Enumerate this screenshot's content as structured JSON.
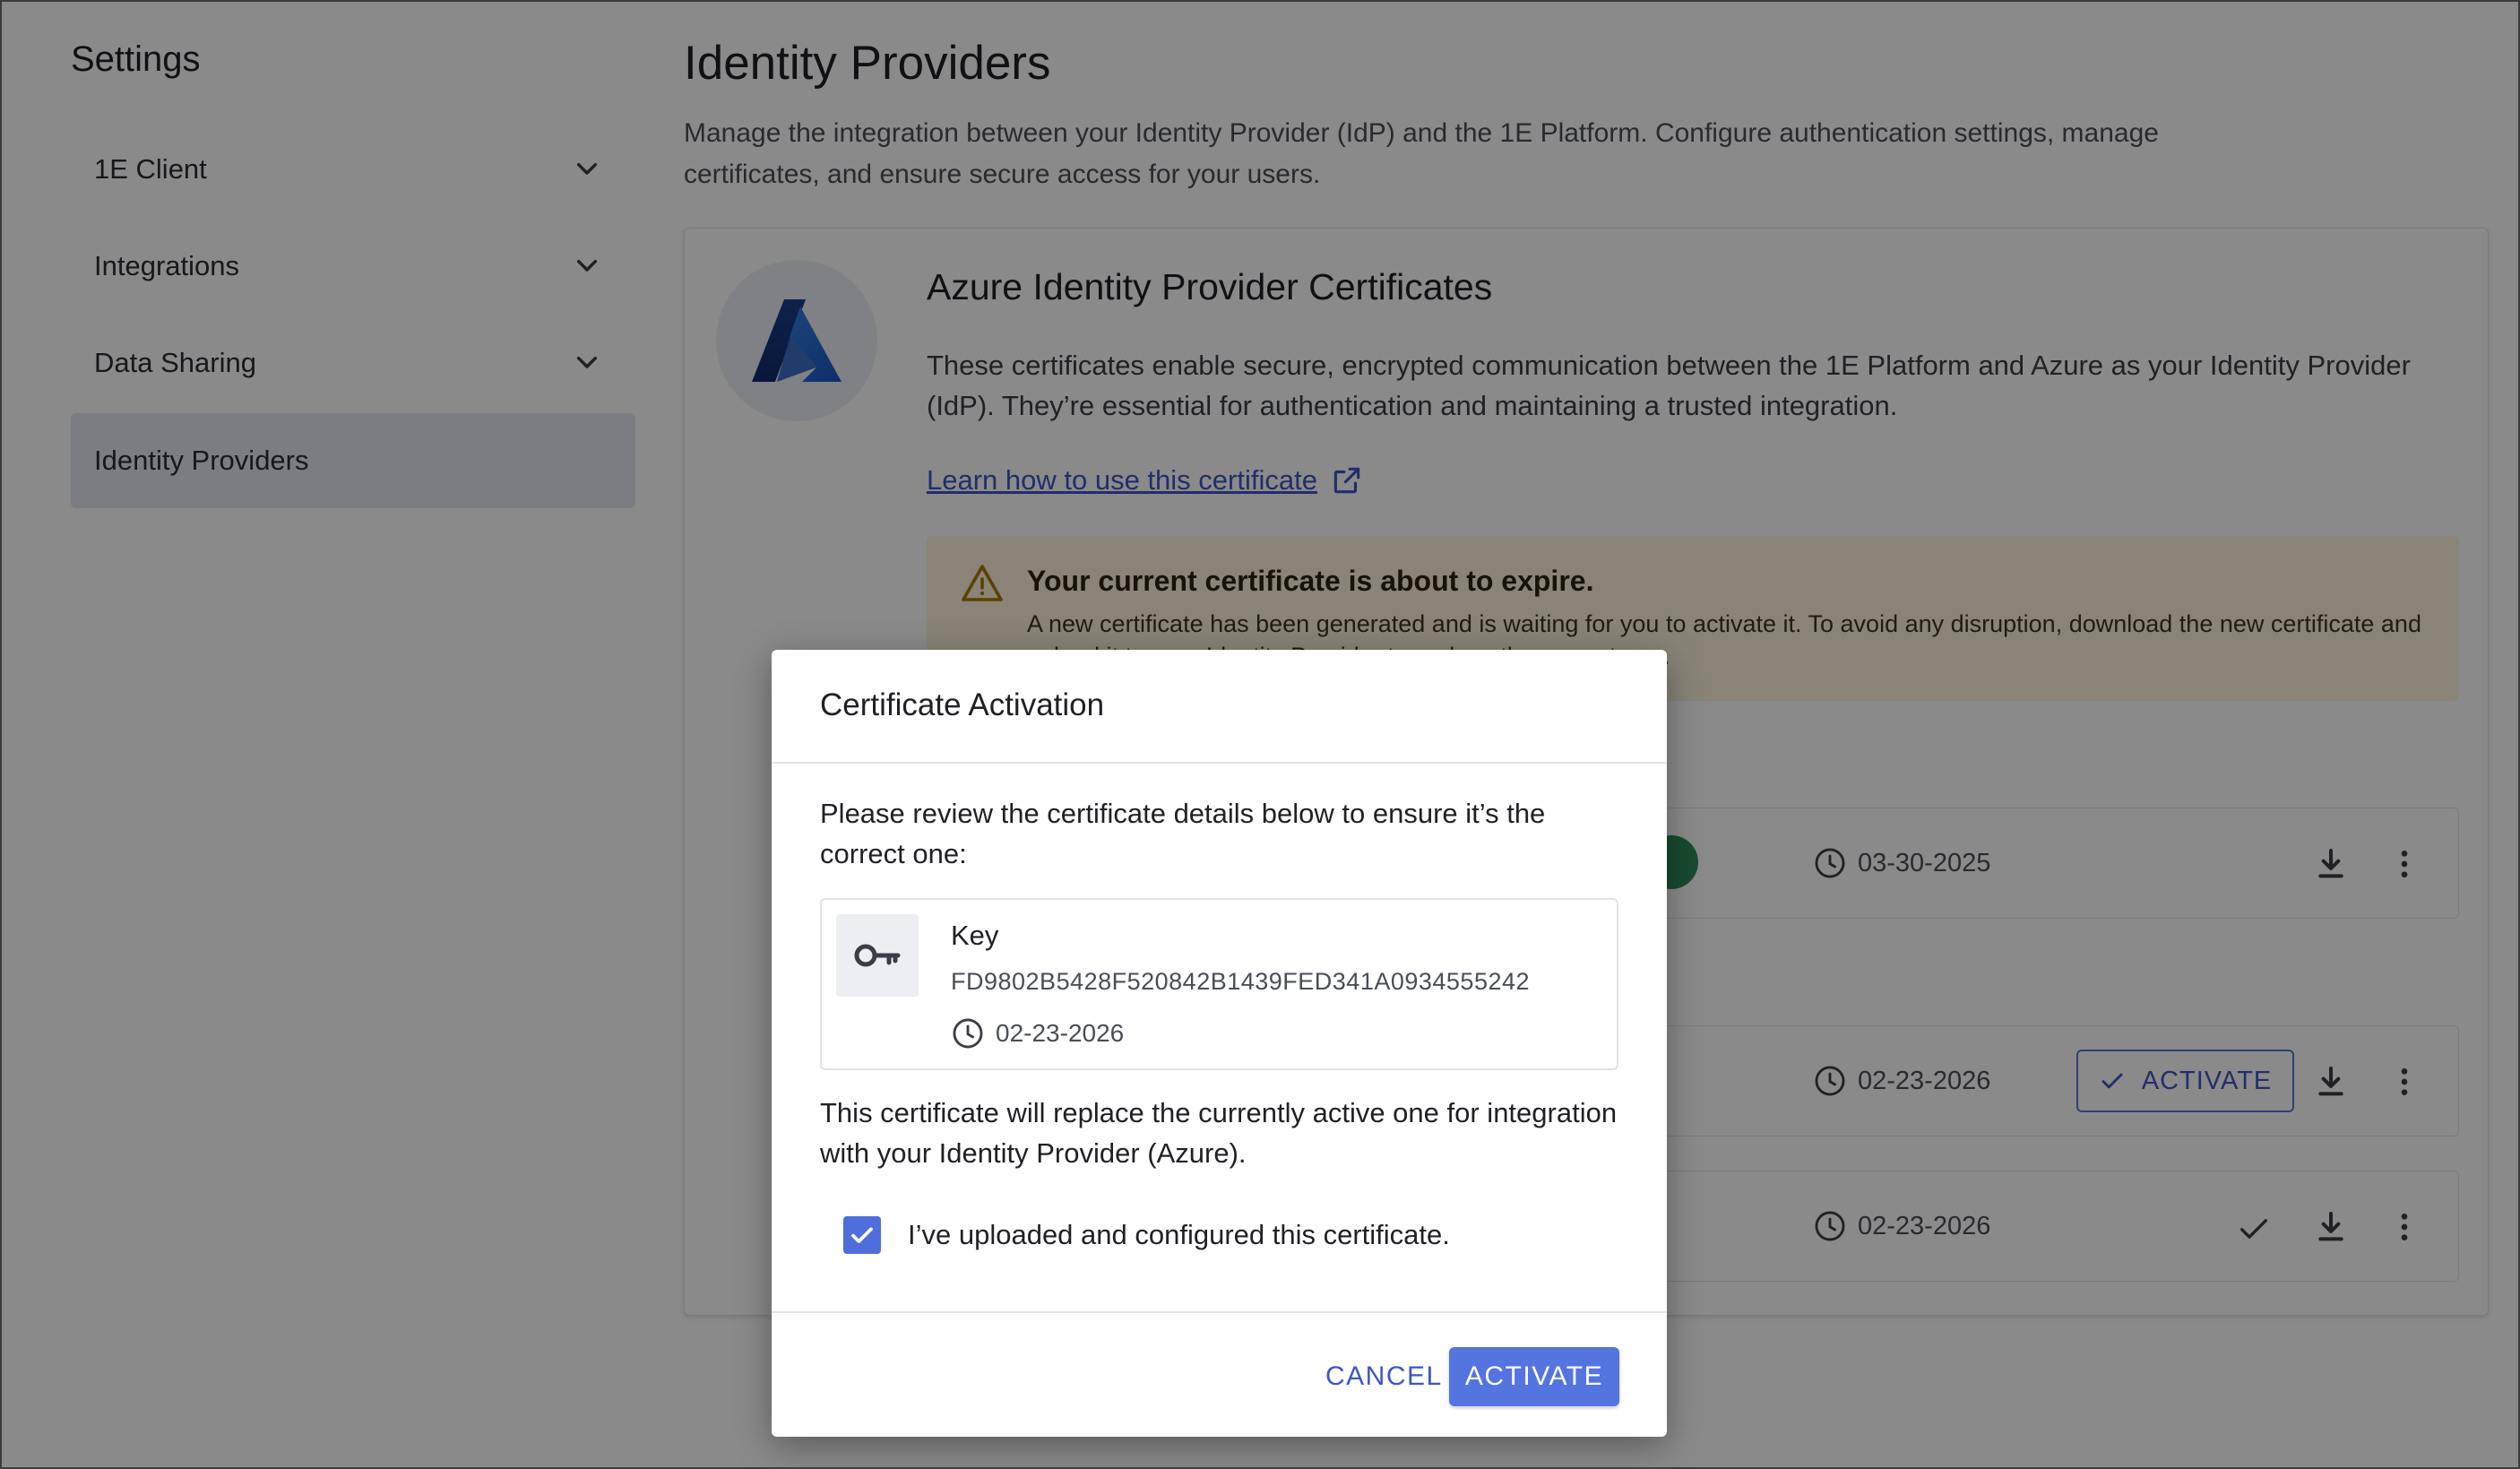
{
  "sidebar": {
    "title": "Settings",
    "items": [
      {
        "label": "1E Client"
      },
      {
        "label": "Integrations"
      },
      {
        "label": "Data Sharing"
      },
      {
        "label": "Identity Providers"
      }
    ]
  },
  "main": {
    "title": "Identity Providers",
    "description": "Manage the integration between your Identity Provider (IdP) and the 1E Platform. Configure authentication settings, manage certificates, and ensure secure access for your users."
  },
  "card": {
    "title": "Azure Identity Provider Certificates",
    "description": "These certificates enable secure, encrypted communication between the 1E Platform and Azure as your Identity Provider (IdP). They’re essential for authentication and maintaining a trusted integration.",
    "learn_link": "Learn how to use this certificate",
    "alert": {
      "title": "Your current certificate is about to expire.",
      "body": "A new certificate has been generated and is waiting for you to activate it. To avoid any disruption, download the new certificate and upload it to your Identity Provider to replace the current one."
    },
    "rows": [
      {
        "date": "03-30-2025"
      },
      {
        "date": "02-23-2026",
        "action_label": "ACTIVATE"
      },
      {
        "date": "02-23-2026"
      }
    ]
  },
  "modal": {
    "title": "Certificate Activation",
    "intro": "Please review the certificate details below to ensure it’s the correct one:",
    "cert": {
      "label": "Key",
      "value": "FD9802B5428F520842B1439FED341A0934555242",
      "date": "02-23-2026"
    },
    "replace_text": "This certificate will replace the currently active one for integration with your Identity Provider (Azure).",
    "checkbox_label": "I’ve uploaded and configured this certificate.",
    "checkbox_checked": true,
    "cancel_label": "CANCEL",
    "activate_label": "ACTIVATE"
  },
  "colors": {
    "accent": "#5474e0",
    "link": "#3d56c5",
    "alert_bg": "#fdf4dc",
    "sidebar_active": "#e3e8f3"
  }
}
